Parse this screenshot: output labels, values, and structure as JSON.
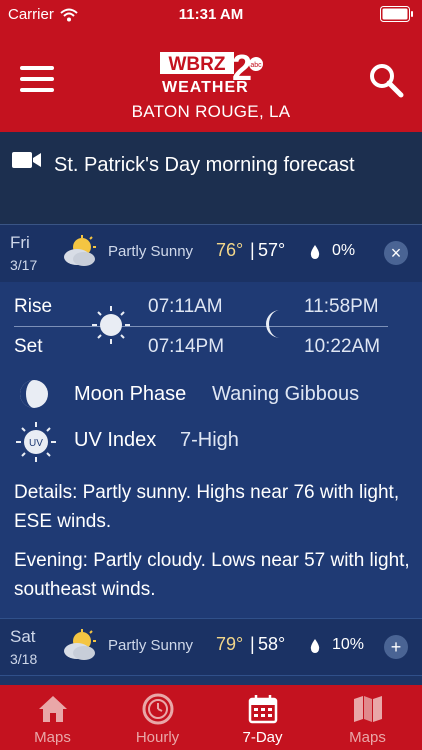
{
  "status_bar": {
    "carrier": "Carrier",
    "time": "11:31 AM"
  },
  "header": {
    "logo_top": "WBRZ",
    "logo_number": "2",
    "logo_bottom": "WEATHER",
    "logo_badge": "abc",
    "location": "BATON ROUGE, LA"
  },
  "video": {
    "title": "St. Patrick's Day morning forecast"
  },
  "days": [
    {
      "day": "Fri",
      "date": "3/17",
      "condition": "Partly Sunny",
      "high": "76°",
      "low": "57°",
      "precip": "0%",
      "toggle": "×"
    },
    {
      "day": "Sat",
      "date": "3/18",
      "condition": "Partly Sunny",
      "high": "79°",
      "low": "58°",
      "precip": "10%",
      "toggle": "+"
    }
  ],
  "separator": "|",
  "details": {
    "rise_label": "Rise",
    "set_label": "Set",
    "sunrise": "07:11AM",
    "sunset": "07:14PM",
    "moonrise": "11:58PM",
    "moonset": "10:22AM",
    "moon_phase_label": "Moon Phase",
    "moon_phase_value": "Waning Gibbous",
    "uv_label": "UV Index",
    "uv_value": "7-High",
    "uv_icon_text": "UV",
    "details_text": "Details: Partly sunny. Highs near 76 with light, ESE winds.",
    "evening_text": "Evening: Partly cloudy. Lows near 57 with light, southeast winds."
  },
  "tabs": [
    {
      "label": "Maps",
      "icon": "home-icon",
      "active": false
    },
    {
      "label": "Hourly",
      "icon": "clock-icon",
      "active": false
    },
    {
      "label": "7-Day",
      "icon": "calendar-icon",
      "active": true
    },
    {
      "label": "Maps",
      "icon": "map-icon",
      "active": false
    }
  ],
  "colors": {
    "header_red": "#c4121f",
    "panel_blue": "#1f3a74",
    "row_blue": "#1b3264",
    "high_temp": "#f2d68a"
  }
}
